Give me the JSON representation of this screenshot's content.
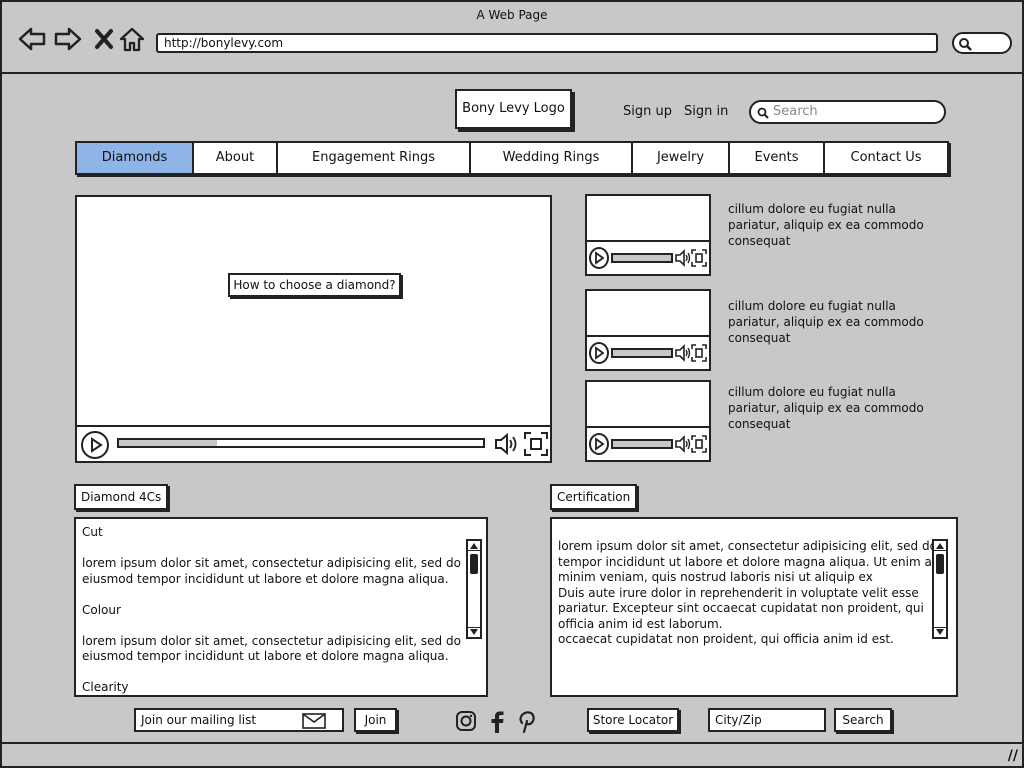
{
  "window": {
    "title": "A Web Page"
  },
  "browser": {
    "url": "http://bonylevy.com"
  },
  "header": {
    "logo": "Bony Levy Logo",
    "signup": "Sign up",
    "signin": "Sign in",
    "search_placeholder": "Search"
  },
  "nav": {
    "tabs": [
      {
        "label": "Diamonds",
        "active": true
      },
      {
        "label": "About"
      },
      {
        "label": "Engagement Rings"
      },
      {
        "label": "Wedding Rings"
      },
      {
        "label": "Jewelry"
      },
      {
        "label": "Events"
      },
      {
        "label": "Contact Us"
      }
    ]
  },
  "main_video": {
    "caption": "How to choose a diamond?",
    "progress": 0.27
  },
  "side_videos": [
    {
      "text": "cillum dolore eu fugiat nulla pariatur, aliquip ex ea commodo consequat"
    },
    {
      "text": "cillum dolore eu fugiat nulla pariatur, aliquip ex ea commodo consequat"
    },
    {
      "text": "cillum dolore eu fugiat nulla pariatur, aliquip ex ea commodo consequat"
    }
  ],
  "sections": {
    "diamond4cs": {
      "label": "Diamond 4Cs",
      "lines": [
        "Cut",
        "",
        "lorem ipsum dolor sit amet, consectetur adipisicing elit, sed do",
        "eiusmod tempor incididunt ut labore et dolore magna aliqua.",
        "",
        "Colour",
        "",
        "lorem ipsum dolor sit amet, consectetur adipisicing elit, sed do",
        "eiusmod tempor incididunt ut labore et dolore magna aliqua.",
        "",
        "Clearity"
      ]
    },
    "certification": {
      "label": "Certification",
      "lines": [
        "lorem ipsum dolor sit amet, consectetur adipisicing elit, sed do",
        "tempor incididunt ut labore et dolore magna aliqua. Ut enim ad",
        "minim veniam, quis nostrud  laboris nisi ut aliquip ex",
        "Duis aute irure dolor in reprehenderit in voluptate velit esse",
        "pariatur. Excepteur sint occaecat cupidatat non proident, qui",
        "officia  anim id est laborum.",
        "occaecat cupidatat non proident, qui officia  anim id est."
      ]
    }
  },
  "footer": {
    "mailing_placeholder": "Join our mailing list",
    "join_label": "Join",
    "social": [
      "instagram-icon",
      "facebook-icon",
      "pinterest-icon"
    ],
    "store_locator": "Store Locator",
    "city_placeholder": "City/Zip",
    "search_label": "Search"
  },
  "colors": {
    "active_tab": "#8fb4e8",
    "background": "#c8c8c8"
  }
}
